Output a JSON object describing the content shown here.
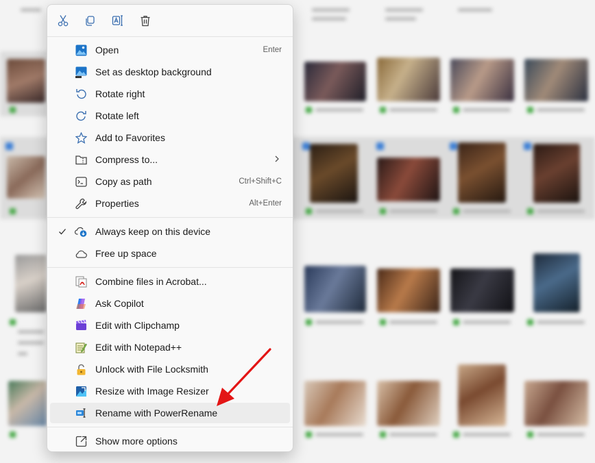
{
  "quick_actions": [
    {
      "name": "cut-icon"
    },
    {
      "name": "copy-icon"
    },
    {
      "name": "rename-icon"
    },
    {
      "name": "delete-icon"
    }
  ],
  "menu": {
    "open": {
      "label": "Open",
      "shortcut": "Enter",
      "icon": "photo-icon"
    },
    "set_bg": {
      "label": "Set as desktop background",
      "icon": "desktop-background-icon"
    },
    "rotate_right": {
      "label": "Rotate right",
      "icon": "rotate-right-icon"
    },
    "rotate_left": {
      "label": "Rotate left",
      "icon": "rotate-left-icon"
    },
    "favorites": {
      "label": "Add to Favorites",
      "icon": "star-icon"
    },
    "compress": {
      "label": "Compress to...",
      "icon": "zip-folder-icon"
    },
    "copy_path": {
      "label": "Copy as path",
      "shortcut": "Ctrl+Shift+C",
      "icon": "copy-path-icon"
    },
    "properties": {
      "label": "Properties",
      "shortcut": "Alt+Enter",
      "icon": "wrench-icon"
    },
    "keep": {
      "label": "Always keep on this device",
      "checked": true,
      "icon": "cloud-sync-icon"
    },
    "free": {
      "label": "Free up space",
      "icon": "cloud-icon"
    },
    "acrobat": {
      "label": "Combine files in Acrobat...",
      "icon": "acrobat-icon"
    },
    "copilot": {
      "label": "Ask Copilot",
      "icon": "copilot-icon"
    },
    "clipchamp": {
      "label": "Edit with Clipchamp",
      "icon": "clipchamp-icon"
    },
    "notepad": {
      "label": "Edit with Notepad++",
      "icon": "notepadpp-icon"
    },
    "locksmith": {
      "label": "Unlock with File Locksmith",
      "icon": "lock-icon"
    },
    "resizer": {
      "label": "Resize with Image Resizer",
      "icon": "image-resizer-icon"
    },
    "powerrename": {
      "label": "Rename with PowerRename",
      "icon": "powerrename-icon"
    },
    "more": {
      "label": "Show more options",
      "icon": "show-more-icon"
    }
  },
  "colors": {
    "accent": "#0067c0",
    "arrow": "#e31515",
    "menu_bg": "#f9f9f9",
    "hover": "#ececec"
  }
}
